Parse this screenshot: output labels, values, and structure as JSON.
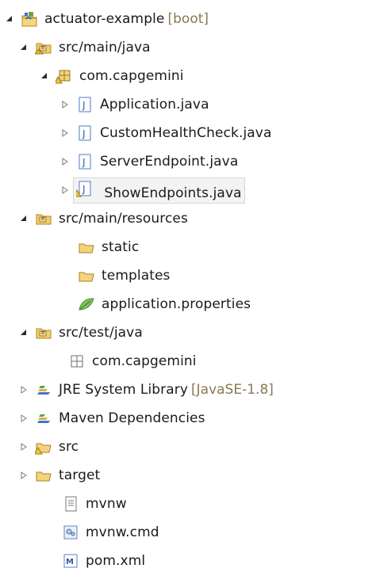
{
  "tree": {
    "root": {
      "label": "actuator-example",
      "suffix": "[boot]"
    },
    "src_main_java": "src/main/java",
    "package_main": "com.capgemini",
    "application": "Application.java",
    "custom_health": "CustomHealthCheck.java",
    "server_endpoint": "ServerEndpoint.java",
    "show_endpoints": "ShowEndpoints.java",
    "src_main_resources": "src/main/resources",
    "static": "static",
    "templates": "templates",
    "application_properties": "application.properties",
    "src_test_java": "src/test/java",
    "package_test": "com.capgemini",
    "jre": {
      "label": "JRE System Library",
      "suffix": "[JavaSE-1.8]"
    },
    "maven": "Maven Dependencies",
    "src": "src",
    "target": "target",
    "mvnw": "mvnw",
    "mvnw_cmd": "mvnw.cmd",
    "pom": "pom.xml"
  },
  "icons": {
    "project": "maven-spring-project-icon",
    "source_folder": "source-folder-icon",
    "package": "package-icon",
    "java_file": "java-file-icon",
    "folder": "folder-icon",
    "properties": "properties-leaf-icon",
    "library": "library-icon",
    "file": "text-file-icon",
    "cmd": "cmd-file-icon",
    "xml": "maven-xml-icon"
  }
}
